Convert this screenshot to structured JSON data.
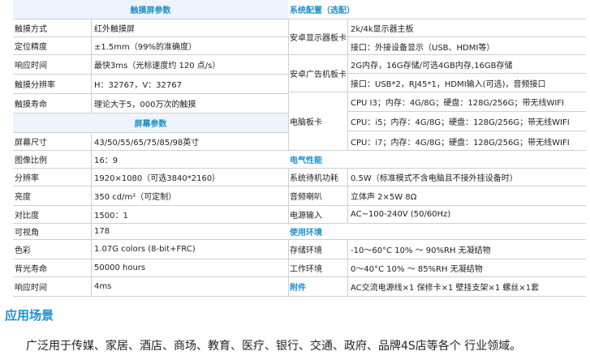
{
  "left_sections": [
    {
      "title": "触摸屏参数",
      "rows": [
        {
          "label": "触摸方式",
          "value": "红外触摸屏"
        },
        {
          "label": "定位精度",
          "value": "±1.5mm（99%的准确度）"
        },
        {
          "label": "响应时间",
          "value": "最快3ms（光标速度约 120 点/s）"
        },
        {
          "label": "触摸分辨率",
          "value": "H：32767，V：32767"
        },
        {
          "label": "触摸寿命",
          "value": "理论大于5，000万次的触摸"
        }
      ]
    },
    {
      "title": "屏幕参数",
      "rows": [
        {
          "label": "屏幕尺寸",
          "value": "43/50/55/65/75/85/98英寸"
        },
        {
          "label": "图像比例",
          "value": "16：9"
        },
        {
          "label": "分辨率",
          "value": "1920×1080（可选3840*2160）"
        },
        {
          "label": "亮度",
          "value": "350 cd/m²（可定制）"
        },
        {
          "label": "对比度",
          "value": "1500：1"
        },
        {
          "label": "可视角",
          "value": "178"
        },
        {
          "label": "色彩",
          "value": "1.07G colors (8-bit+FRC)"
        },
        {
          "label": "背光寿命",
          "value": "50000 hours"
        },
        {
          "label": "响应时间",
          "value": "4ms"
        }
      ]
    }
  ],
  "right": {
    "system_title": "系统配置（选配）",
    "android_mainboard": {
      "label": "安卓显示器板卡",
      "lines": [
        "2k/4k显示器主板",
        "接口：外接设备显示（USB、HDMI等）"
      ]
    },
    "android_ad_board": {
      "label": "安卓广告机板卡",
      "lines": [
        "2G内存，16G存储/可选4GB内存,16GB存储",
        "接口：USB*2，RJ45*1，HDMI输入(可选)，音频接口"
      ]
    },
    "pc_board": {
      "label": "电脑板卡",
      "lines": [
        "CPU I3；内存：4G/8G；硬盘：128G/256G；带无线WIFI",
        "CPU：i5；内存：4G/8G；硬盘：128G/256G；带无线WIFI",
        "CPU：i7；内存：4G/8G；硬盘：128G/256G；带无线WIFI"
      ]
    },
    "electrical_title": "电气性能",
    "electrical_rows": [
      {
        "label": "系统待机功耗",
        "value": "0.5W（标准模式不含电脑且不接外挂设备时）"
      },
      {
        "label": "音频喇叭",
        "value": "立体声 2×5W 8Ω"
      },
      {
        "label": "电源输入",
        "value": "AC~100-240V (50/60Hz)"
      }
    ],
    "env_title": "使用环境",
    "env_rows": [
      {
        "label": "存储环境",
        "value": "-10～60°C 10% ～ 90%RH 无凝结物"
      },
      {
        "label": "工作环境",
        "value": "0～40°C 10% ～ 85%RH 无凝结物"
      }
    ],
    "accessories_label": "附件",
    "accessories_value": "AC交流电源线×1  保修卡×1 壁挂支架×1 螺丝×1套"
  },
  "application": {
    "title": "应用场景",
    "text": "广泛用于传媒、家居、酒店、商场、教育、医疗、银行、交通、政府、品牌4S店等各个  行业领域。"
  }
}
